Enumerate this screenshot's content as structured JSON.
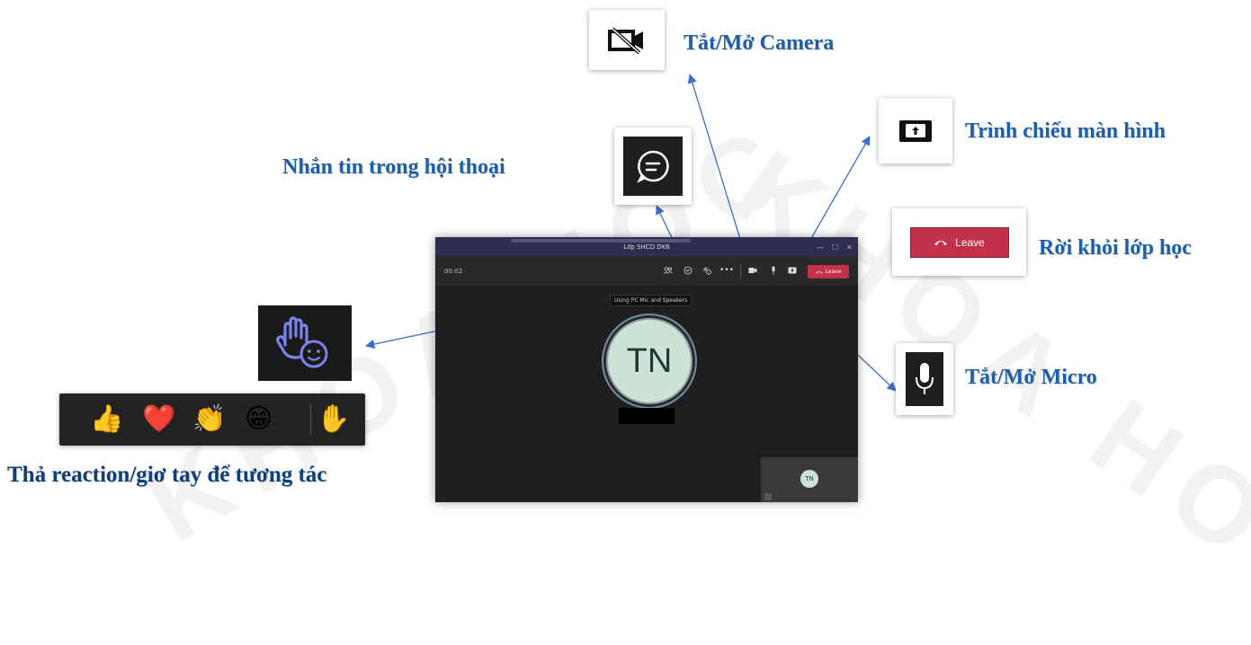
{
  "labels": {
    "camera": "Tắt/Mở Camera",
    "share": "Trình chiếu màn hình",
    "chat": "Nhắn tin trong hội thoại",
    "leave": "Rời khỏi lớp học",
    "micro": "Tắt/Mở Micro",
    "reaction": "Thả reaction/giơ tay để tương tác"
  },
  "callouts": {
    "leave_button_label": "Leave"
  },
  "window": {
    "title": "Lớp SHCD DK6",
    "timer": "00:02",
    "minimize": "—",
    "maximize": "☐",
    "close": "✕",
    "leave_label": "Leave",
    "tooltip": "Using PC Mic and Speakers",
    "avatar_initials": "TN",
    "self_initials": "TN"
  },
  "reactions": [
    "👍",
    "❤️",
    "👏",
    "😁",
    "✋"
  ],
  "watermark": "KHOA HOC",
  "colors": {
    "label_blue": "#1f5fa8",
    "leave_red": "#c4314b",
    "teams_purple": "#2e2d50",
    "raise_hand_purple": "#7b83eb"
  }
}
